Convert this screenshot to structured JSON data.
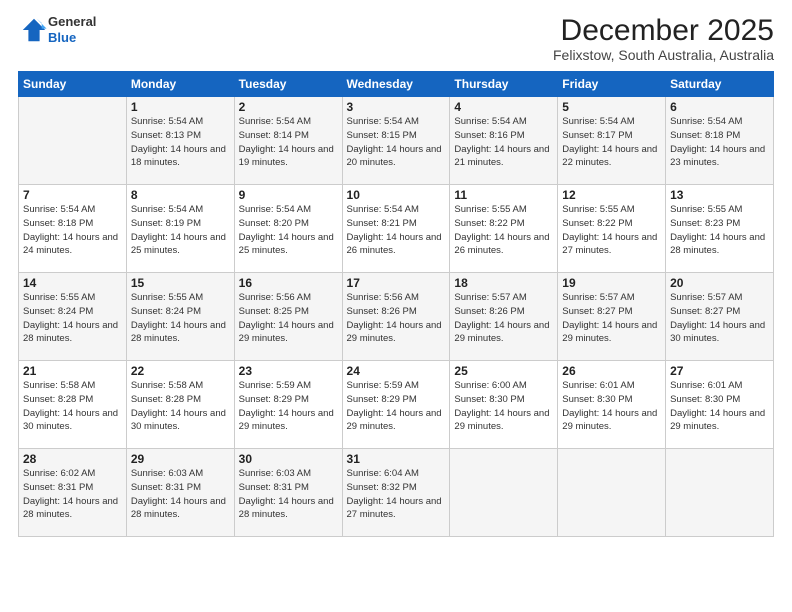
{
  "logo": {
    "line1": "General",
    "line2": "Blue"
  },
  "title": "December 2025",
  "subtitle": "Felixstow, South Australia, Australia",
  "headers": [
    "Sunday",
    "Monday",
    "Tuesday",
    "Wednesday",
    "Thursday",
    "Friday",
    "Saturday"
  ],
  "weeks": [
    [
      {
        "day": "",
        "info": ""
      },
      {
        "day": "1",
        "info": "Sunrise: 5:54 AM\nSunset: 8:13 PM\nDaylight: 14 hours\nand 18 minutes."
      },
      {
        "day": "2",
        "info": "Sunrise: 5:54 AM\nSunset: 8:14 PM\nDaylight: 14 hours\nand 19 minutes."
      },
      {
        "day": "3",
        "info": "Sunrise: 5:54 AM\nSunset: 8:15 PM\nDaylight: 14 hours\nand 20 minutes."
      },
      {
        "day": "4",
        "info": "Sunrise: 5:54 AM\nSunset: 8:16 PM\nDaylight: 14 hours\nand 21 minutes."
      },
      {
        "day": "5",
        "info": "Sunrise: 5:54 AM\nSunset: 8:17 PM\nDaylight: 14 hours\nand 22 minutes."
      },
      {
        "day": "6",
        "info": "Sunrise: 5:54 AM\nSunset: 8:18 PM\nDaylight: 14 hours\nand 23 minutes."
      }
    ],
    [
      {
        "day": "7",
        "info": "Sunrise: 5:54 AM\nSunset: 8:18 PM\nDaylight: 14 hours\nand 24 minutes."
      },
      {
        "day": "8",
        "info": "Sunrise: 5:54 AM\nSunset: 8:19 PM\nDaylight: 14 hours\nand 25 minutes."
      },
      {
        "day": "9",
        "info": "Sunrise: 5:54 AM\nSunset: 8:20 PM\nDaylight: 14 hours\nand 25 minutes."
      },
      {
        "day": "10",
        "info": "Sunrise: 5:54 AM\nSunset: 8:21 PM\nDaylight: 14 hours\nand 26 minutes."
      },
      {
        "day": "11",
        "info": "Sunrise: 5:55 AM\nSunset: 8:22 PM\nDaylight: 14 hours\nand 26 minutes."
      },
      {
        "day": "12",
        "info": "Sunrise: 5:55 AM\nSunset: 8:22 PM\nDaylight: 14 hours\nand 27 minutes."
      },
      {
        "day": "13",
        "info": "Sunrise: 5:55 AM\nSunset: 8:23 PM\nDaylight: 14 hours\nand 28 minutes."
      }
    ],
    [
      {
        "day": "14",
        "info": "Sunrise: 5:55 AM\nSunset: 8:24 PM\nDaylight: 14 hours\nand 28 minutes."
      },
      {
        "day": "15",
        "info": "Sunrise: 5:55 AM\nSunset: 8:24 PM\nDaylight: 14 hours\nand 28 minutes."
      },
      {
        "day": "16",
        "info": "Sunrise: 5:56 AM\nSunset: 8:25 PM\nDaylight: 14 hours\nand 29 minutes."
      },
      {
        "day": "17",
        "info": "Sunrise: 5:56 AM\nSunset: 8:26 PM\nDaylight: 14 hours\nand 29 minutes."
      },
      {
        "day": "18",
        "info": "Sunrise: 5:57 AM\nSunset: 8:26 PM\nDaylight: 14 hours\nand 29 minutes."
      },
      {
        "day": "19",
        "info": "Sunrise: 5:57 AM\nSunset: 8:27 PM\nDaylight: 14 hours\nand 29 minutes."
      },
      {
        "day": "20",
        "info": "Sunrise: 5:57 AM\nSunset: 8:27 PM\nDaylight: 14 hours\nand 30 minutes."
      }
    ],
    [
      {
        "day": "21",
        "info": "Sunrise: 5:58 AM\nSunset: 8:28 PM\nDaylight: 14 hours\nand 30 minutes."
      },
      {
        "day": "22",
        "info": "Sunrise: 5:58 AM\nSunset: 8:28 PM\nDaylight: 14 hours\nand 30 minutes."
      },
      {
        "day": "23",
        "info": "Sunrise: 5:59 AM\nSunset: 8:29 PM\nDaylight: 14 hours\nand 29 minutes."
      },
      {
        "day": "24",
        "info": "Sunrise: 5:59 AM\nSunset: 8:29 PM\nDaylight: 14 hours\nand 29 minutes."
      },
      {
        "day": "25",
        "info": "Sunrise: 6:00 AM\nSunset: 8:30 PM\nDaylight: 14 hours\nand 29 minutes."
      },
      {
        "day": "26",
        "info": "Sunrise: 6:01 AM\nSunset: 8:30 PM\nDaylight: 14 hours\nand 29 minutes."
      },
      {
        "day": "27",
        "info": "Sunrise: 6:01 AM\nSunset: 8:30 PM\nDaylight: 14 hours\nand 29 minutes."
      }
    ],
    [
      {
        "day": "28",
        "info": "Sunrise: 6:02 AM\nSunset: 8:31 PM\nDaylight: 14 hours\nand 28 minutes."
      },
      {
        "day": "29",
        "info": "Sunrise: 6:03 AM\nSunset: 8:31 PM\nDaylight: 14 hours\nand 28 minutes."
      },
      {
        "day": "30",
        "info": "Sunrise: 6:03 AM\nSunset: 8:31 PM\nDaylight: 14 hours\nand 28 minutes."
      },
      {
        "day": "31",
        "info": "Sunrise: 6:04 AM\nSunset: 8:32 PM\nDaylight: 14 hours\nand 27 minutes."
      },
      {
        "day": "",
        "info": ""
      },
      {
        "day": "",
        "info": ""
      },
      {
        "day": "",
        "info": ""
      }
    ]
  ]
}
